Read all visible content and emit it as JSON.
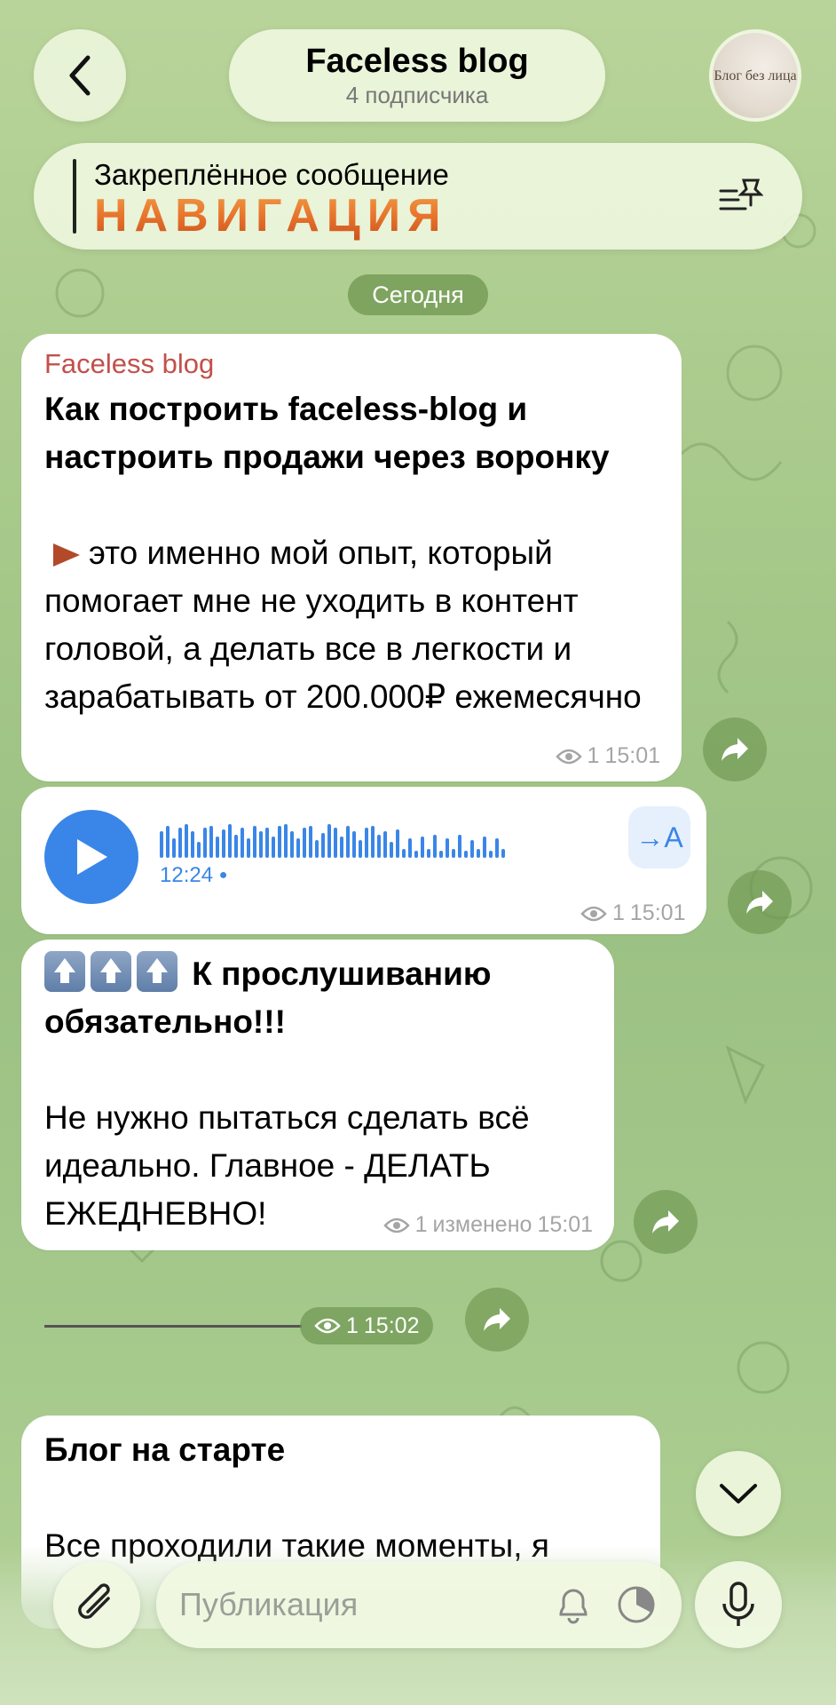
{
  "header": {
    "back_icon": "chevron-left-icon",
    "channel_title": "Faceless blog",
    "subscribers": "4 подписчика",
    "avatar_text": "Блог без лица"
  },
  "pinned": {
    "label": "Закреплённое сообщение",
    "title": "НАВИГАЦИЯ",
    "icon": "pin-list-icon"
  },
  "date_separator": "Сегодня",
  "messages": [
    {
      "sender": "Faceless blog",
      "headline": "Как построить faceless-blog и настроить продажи через воронку",
      "bullet_icon": "play-triangle-icon",
      "body": "это именно мой опыт, который помогает мне не уходить в контент головой, а делать все в легкости и зарабатывать от 200.000₽ ежемесячно",
      "views": "1",
      "time": "15:01"
    },
    {
      "type": "voice",
      "duration": "12:24",
      "translate_label": "→A",
      "views": "1",
      "time": "15:01"
    },
    {
      "headline": "К прослушиванию обязательно!!!",
      "body": "Не нужно пытаться сделать всё идеально. Главное - ДЕЛАТЬ ЕЖЕДНЕВНО!",
      "views": "1",
      "edited": "изменено",
      "time": "15:01"
    },
    {
      "type": "line",
      "views": "1",
      "time": "15:02"
    },
    {
      "headline": "Блог на старте",
      "body": "Все проходили такие моменты, я"
    }
  ],
  "composer": {
    "placeholder": "Публикация",
    "attach_icon": "paperclip-icon",
    "bell_icon": "bell-icon",
    "timer_icon": "timer-icon",
    "mic_icon": "microphone-icon"
  },
  "colors": {
    "accent_blue": "#3a86e8",
    "sender_red": "#c2504a",
    "bubble": "#ffffff",
    "chip_green": "#6e9650"
  }
}
